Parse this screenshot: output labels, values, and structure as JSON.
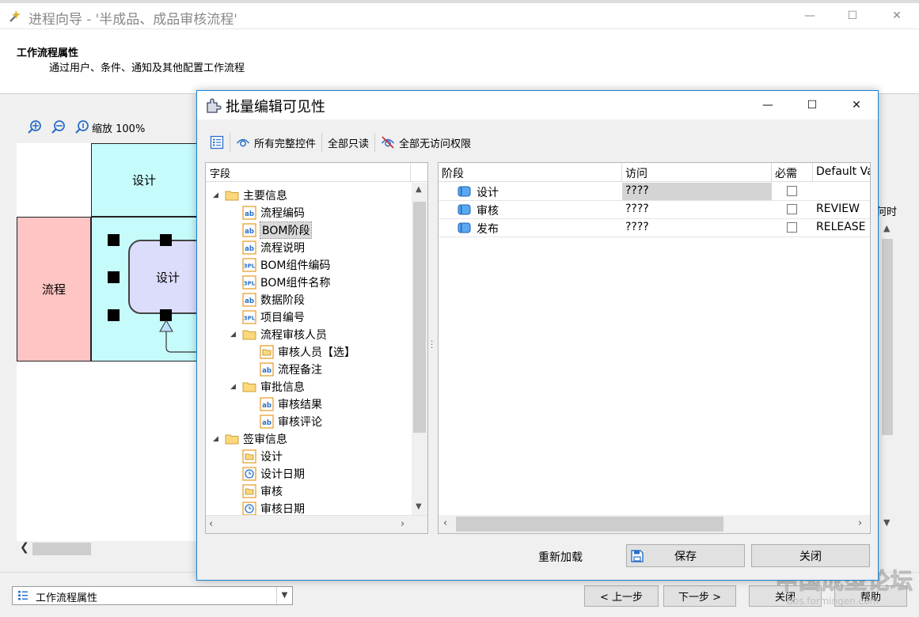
{
  "wizard": {
    "title": "进程向导 - '半成品、成品审核流程'",
    "header_title": "工作流程属性",
    "header_subtitle": "通过用户、条件、通知及其他配置工作流程",
    "zoom_label": "缩放 100%",
    "lanes": {
      "design_header": "设计",
      "process_label": "流程",
      "activity_label": "设计"
    },
    "right_col_text": "何时",
    "footer": {
      "step_value": "工作流程属性",
      "prev_label": "< 上一步",
      "next_label": "下一步 >",
      "close_label": "关闭",
      "help_label": "帮助"
    }
  },
  "watermark": {
    "main": "中国成型论坛",
    "sub": "bbs.formingen.com"
  },
  "dialog": {
    "title": "批量编辑可见性",
    "toolbar": {
      "all_full_label": "所有完整控件",
      "all_readonly_label": "全部只读",
      "all_noaccess_label": "全部无访问权限"
    },
    "tree": {
      "header": "字段",
      "nodes": [
        {
          "label": "主要信息"
        },
        {
          "label": "流程编码"
        },
        {
          "label": "BOM阶段"
        },
        {
          "label": "流程说明"
        },
        {
          "label": "BOM组件编码"
        },
        {
          "label": "BOM组件名称"
        },
        {
          "label": "数据阶段"
        },
        {
          "label": "项目编号"
        },
        {
          "label": "流程审核人员"
        },
        {
          "label": "审核人员【选】"
        },
        {
          "label": "流程备注"
        },
        {
          "label": "审批信息"
        },
        {
          "label": "审核结果"
        },
        {
          "label": "审核评论"
        },
        {
          "label": "签审信息"
        },
        {
          "label": "设计"
        },
        {
          "label": "设计日期"
        },
        {
          "label": "审核"
        },
        {
          "label": "审核日期"
        }
      ]
    },
    "grid": {
      "columns": {
        "phase": "阶段",
        "access": "访问",
        "required": "必需",
        "default": "Default Value"
      },
      "rows": [
        {
          "phase": "设计",
          "access": "????",
          "default": ""
        },
        {
          "phase": "审核",
          "access": "????",
          "default": "REVIEW"
        },
        {
          "phase": "发布",
          "access": "????",
          "default": "RELEASE"
        }
      ]
    },
    "buttons": {
      "reload_label": "重新加载",
      "save_label": "保存",
      "close_label": "关闭"
    }
  }
}
